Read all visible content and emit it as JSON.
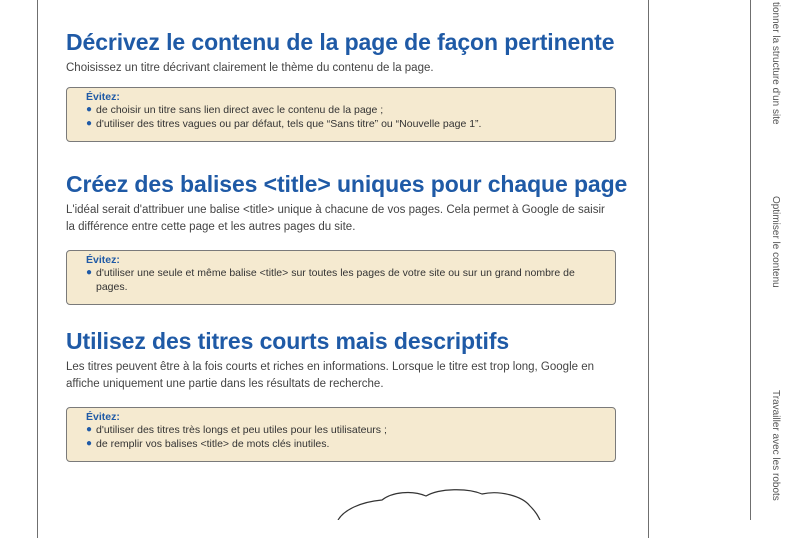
{
  "side_tabs": [
    "tionner la structure d'un site",
    "Optimiser le contenu",
    "Travailler avec les robots"
  ],
  "sections": [
    {
      "heading": "Décrivez le contenu de la page de façon pertinente",
      "paragraph": "Choisissez un titre décrivant clairement le thème du contenu de la page.",
      "avoid_title": "Évitez:",
      "avoid_items": [
        "de choisir un titre sans lien direct avec le contenu de la page ;",
        "d'utiliser des titres vagues ou par défaut, tels que “Sans titre” ou “Nouvelle page 1”."
      ]
    },
    {
      "heading": "Créez des balises <title> uniques pour chaque page",
      "paragraph": "L'idéal serait d'attribuer une balise <title> unique à chacune de vos pages. Cela permet à Google de saisir la différence entre cette page et les autres pages du site.",
      "avoid_title": "Évitez:",
      "avoid_items": [
        "d'utiliser une seule et même balise <title> sur toutes les pages de votre site ou sur un grand nombre de pages."
      ]
    },
    {
      "heading": "Utilisez des titres courts mais descriptifs",
      "paragraph": "Les titres peuvent être à la fois courts et riches en informations. Lorsque le titre est trop long, Google en affiche uniquement une partie dans les résultats de recherche.",
      "avoid_title": "Évitez:",
      "avoid_items": [
        "d'utiliser des titres très longs et peu utiles pour les utilisateurs ;",
        "de remplir vos balises <title> de mots clés inutiles."
      ]
    }
  ],
  "colors": {
    "heading": "#1f5aa6",
    "box_background": "#f5ead0",
    "border": "#6f6f6f"
  }
}
